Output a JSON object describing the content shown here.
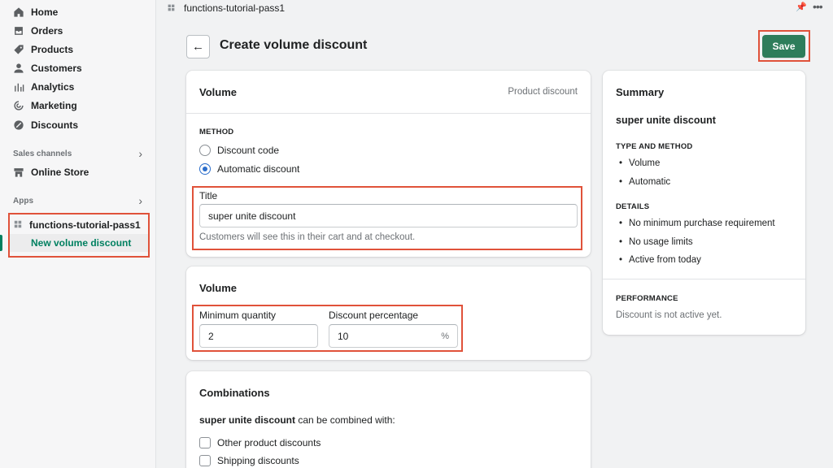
{
  "sidebar": {
    "nav": [
      {
        "label": "Home",
        "icon": "home-icon"
      },
      {
        "label": "Orders",
        "icon": "orders-icon"
      },
      {
        "label": "Products",
        "icon": "tag-icon"
      },
      {
        "label": "Customers",
        "icon": "person-icon"
      },
      {
        "label": "Analytics",
        "icon": "bar-chart-icon"
      },
      {
        "label": "Marketing",
        "icon": "target-icon"
      },
      {
        "label": "Discounts",
        "icon": "discount-icon"
      }
    ],
    "sales_channels_label": "Sales channels",
    "online_store_label": "Online Store",
    "apps_label": "Apps",
    "app_name": "functions-tutorial-pass1",
    "app_subitem": "New volume discount"
  },
  "topbar": {
    "title": "functions-tutorial-pass1"
  },
  "header": {
    "title": "Create volume discount",
    "save_label": "Save",
    "back_glyph": "←"
  },
  "volume_card": {
    "title": "Volume",
    "type_label": "Product discount",
    "method_label": "METHOD",
    "method_options": [
      "Discount code",
      "Automatic discount"
    ],
    "selected_method": "Automatic discount",
    "title_field_label": "Title",
    "title_value": "super unite discount",
    "title_help": "Customers will see this in their cart and at checkout."
  },
  "quantity_card": {
    "title": "Volume",
    "min_qty_label": "Minimum quantity",
    "min_qty_value": "2",
    "pct_label": "Discount percentage",
    "pct_value": "10",
    "pct_suffix": "%"
  },
  "combinations_card": {
    "title": "Combinations",
    "intro_bold": "super unite discount",
    "intro_rest": " can be combined with:",
    "options": [
      "Other product discounts",
      "Shipping discounts"
    ]
  },
  "summary": {
    "title": "Summary",
    "discount_name": "super unite discount",
    "type_method_label": "TYPE AND METHOD",
    "type_method_items": [
      "Volume",
      "Automatic"
    ],
    "details_label": "DETAILS",
    "details_items": [
      "No minimum purchase requirement",
      "No usage limits",
      "Active from today"
    ],
    "performance_label": "PERFORMANCE",
    "performance_text": "Discount is not active yet."
  },
  "colors": {
    "accent": "#2e7d5b",
    "highlight": "#e0523a",
    "link_active": "#008060"
  }
}
